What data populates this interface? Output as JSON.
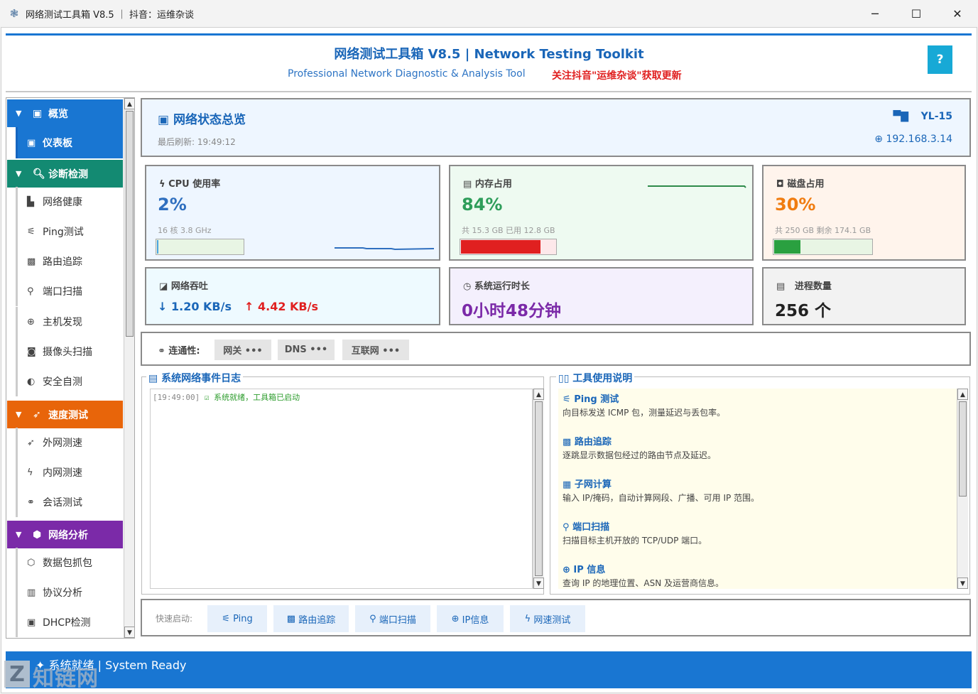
{
  "window": {
    "title": "网络测试工具箱 V8.5 ｜ 抖音：运维杂谈",
    "minimize": "─",
    "maximize": "☐",
    "close": "✕"
  },
  "header": {
    "title": "网络测试工具箱 V8.5 | Network Testing Toolkit",
    "subtitle": "Professional Network Diagnostic & Analysis Tool",
    "follow": "关注抖音\"运维杂谈\"获取更新",
    "help": "?"
  },
  "sidebar": {
    "sections": [
      {
        "label": "概览",
        "color": "#1976d2",
        "items": [
          {
            "label": "仪表板",
            "active": true
          }
        ]
      },
      {
        "label": "诊断检测",
        "color": "#138a72",
        "items": [
          {
            "label": "网络健康"
          },
          {
            "label": "Ping测试"
          },
          {
            "label": "路由追踪"
          },
          {
            "label": "端口扫描"
          },
          {
            "label": "主机发现"
          },
          {
            "label": "摄像头扫描"
          },
          {
            "label": "安全自测"
          }
        ]
      },
      {
        "label": "速度测试",
        "color": "#e8650a",
        "items": [
          {
            "label": "外网测速"
          },
          {
            "label": "内网测速"
          },
          {
            "label": "会话测试"
          }
        ]
      },
      {
        "label": "网络分析",
        "color": "#7b2aa8",
        "items": [
          {
            "label": "数据包抓包"
          },
          {
            "label": "协议分析"
          },
          {
            "label": "DHCP检测"
          }
        ]
      }
    ]
  },
  "overview": {
    "title": "网络状态总览",
    "refresh_label": "最后刷新:",
    "refresh_time": "19:49:12",
    "hostname": "YL-15",
    "ip": "192.168.3.14"
  },
  "cards": {
    "cpu": {
      "label": "CPU 使用率",
      "value": "2%",
      "detail": "16 核  3.8 GHz",
      "percent": 2,
      "color": "#2f6fbf",
      "bg": "#eef6ff"
    },
    "mem": {
      "label": "内存占用",
      "value": "84%",
      "detail": "共 15.3 GB  已用 12.8 GB",
      "percent": 84,
      "color": "#2e9d5a",
      "bg": "#eefaf1",
      "bar_color": "#e02020"
    },
    "disk": {
      "label": "磁盘占用",
      "value": "30%",
      "detail": "共 250 GB  剩余 174.1 GB",
      "percent": 30,
      "color": "#f07c10",
      "bg": "#fff4ec",
      "bar_color": "#2aa040"
    },
    "net": {
      "label": "网络吞吐",
      "down": "↓ 1.20 KB/s",
      "up": "↑ 4.42 KB/s",
      "bg": "#eefaff",
      "down_color": "#1a66b8",
      "up_color": "#e02020"
    },
    "uptime": {
      "label": "系统运行时长",
      "value": "0小时48分钟",
      "bg": "#f4f0fd",
      "color": "#7b2aa8"
    },
    "proc": {
      "label": "进程数量",
      "value": "256 个",
      "bg": "#f2f2f2",
      "color": "#222"
    }
  },
  "connectivity": {
    "label": "连通性:",
    "items": [
      "网关 •••",
      "DNS •••",
      "互联网 •••"
    ]
  },
  "log": {
    "title": "系统网络事件日志",
    "lines": [
      {
        "time": "[19:49:00]",
        "icon": "☑",
        "text": "系统就绪，工具箱已启动"
      }
    ]
  },
  "guide": {
    "title": "工具使用说明",
    "items": [
      {
        "title": "Ping 测试",
        "desc": "向目标发送 ICMP 包，测量延迟与丢包率。"
      },
      {
        "title": "路由追踪",
        "desc": "逐跳显示数据包经过的路由节点及延迟。"
      },
      {
        "title": "子网计算",
        "desc": "输入 IP/掩码，自动计算网段、广播、可用 IP 范围。"
      },
      {
        "title": "端口扫描",
        "desc": "扫描目标主机开放的 TCP/UDP 端口。"
      },
      {
        "title": "IP 信息",
        "desc": "查询 IP 的地理位置、ASN 及运营商信息。"
      }
    ]
  },
  "quick": {
    "label": "快速启动:",
    "buttons": [
      "Ping",
      "路由追踪",
      "端口扫描",
      "IP信息",
      "网速测试"
    ]
  },
  "status": {
    "text": "系统就绪 | System Ready"
  },
  "watermark": {
    "logo": "Z",
    "text": "知链网"
  }
}
